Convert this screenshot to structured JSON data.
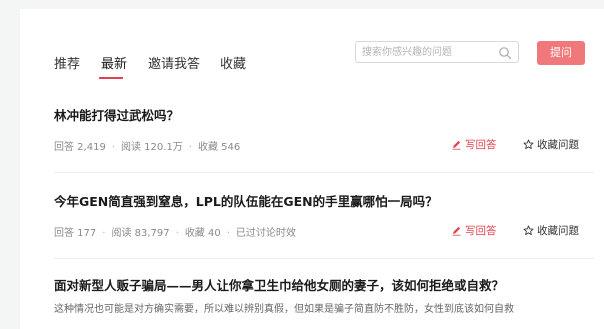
{
  "tabs": [
    {
      "label": "推荐",
      "active": false
    },
    {
      "label": "最新",
      "active": true
    },
    {
      "label": "邀请我答",
      "active": false
    },
    {
      "label": "收藏",
      "active": false
    }
  ],
  "search": {
    "placeholder": "搜索你感兴趣的问题",
    "icon": "search-icon"
  },
  "ask_button": "提问",
  "colors": {
    "accent": "#e3434e",
    "ask_button_bg": "#f0787a"
  },
  "questions": [
    {
      "title": "林冲能打得过武松吗？",
      "meta": [
        "回答 2,419",
        "阅读 120.1万",
        "收藏 546"
      ],
      "write_label": "写回答",
      "fav_label": "收藏问题"
    },
    {
      "title": "今年GEN简直强到窒息，LPL的队伍能在GEN的手里赢哪怕一局吗？",
      "meta": [
        "回答 177",
        "阅读 83,797",
        "收藏 40",
        "已过讨论时效"
      ],
      "write_label": "写回答",
      "fav_label": "收藏问题"
    },
    {
      "title": "面对新型人贩子骗局——男人让你拿卫生巾给他女厕的妻子，该如何拒绝或自救？",
      "excerpt": "这种情况也可能是对方确实需要，所以难以辨别真假，但如果是骗子简直防不胜防，女性到底该如何自救"
    }
  ]
}
